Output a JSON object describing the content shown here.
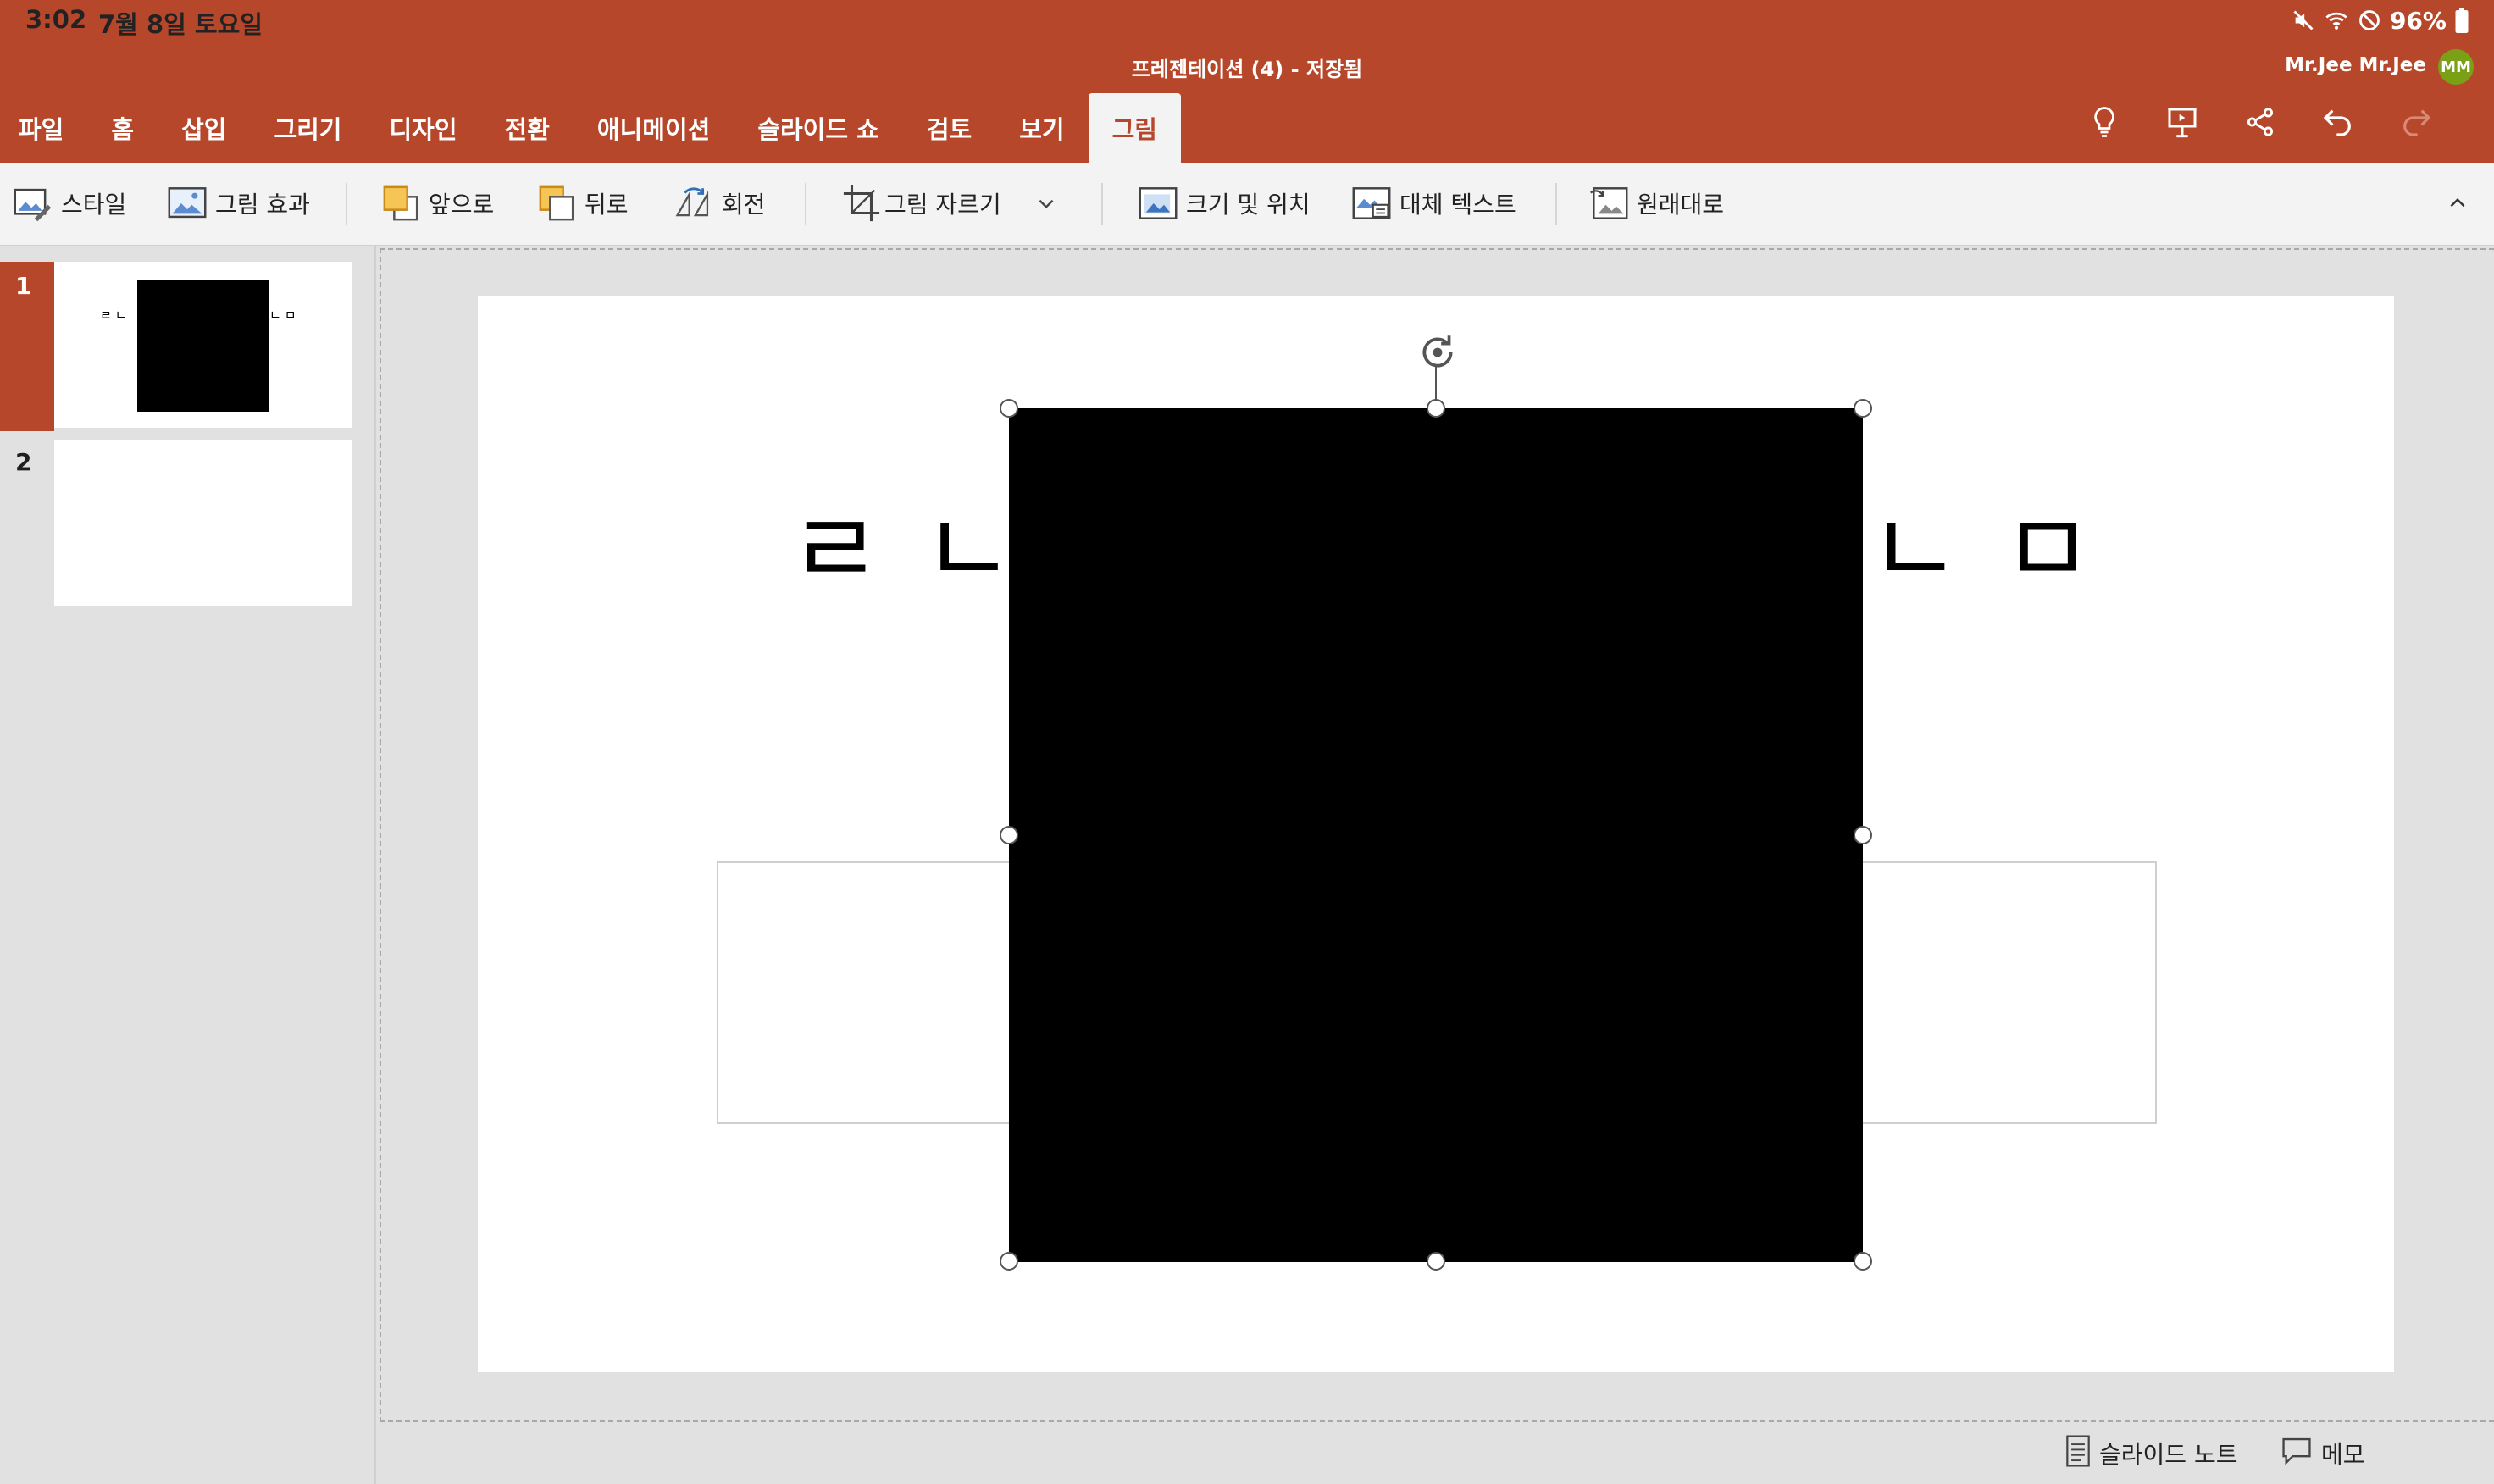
{
  "status_bar": {
    "time": "3:02",
    "date": "7월 8일 토요일",
    "battery": "96%",
    "icons": [
      "mute-icon",
      "wifi-icon",
      "do-not-disturb-icon",
      "battery-icon"
    ]
  },
  "app": {
    "document_title": "프레젠테이션 (4) - 저장됨",
    "user_name": "Mr.Jee Mr.Jee",
    "user_initials": "MM",
    "accent_color": "#b7472a",
    "avatar_color": "#7aa116"
  },
  "tabs": [
    {
      "label": "파일",
      "active": false
    },
    {
      "label": "홈",
      "active": false
    },
    {
      "label": "삽입",
      "active": false
    },
    {
      "label": "그리기",
      "active": false
    },
    {
      "label": "디자인",
      "active": false
    },
    {
      "label": "전환",
      "active": false
    },
    {
      "label": "애니메이션",
      "active": false
    },
    {
      "label": "슬라이드 쇼",
      "active": false
    },
    {
      "label": "검토",
      "active": false
    },
    {
      "label": "보기",
      "active": false
    },
    {
      "label": "그림",
      "active": true
    }
  ],
  "quick_actions": [
    "lightbulb-icon",
    "present-icon",
    "share-icon",
    "undo-icon",
    "redo-icon"
  ],
  "ribbon": {
    "style": "스타일",
    "picture_effects": "그림 효과",
    "bring_forward": "앞으로",
    "send_backward": "뒤로",
    "rotate": "회전",
    "crop": "그림 자르기",
    "size_position": "크기 및 위치",
    "alt_text": "대체 텍스트",
    "reset": "원래대로"
  },
  "slides": [
    {
      "number": "1",
      "selected": true,
      "left_text": "ㄹㄴ",
      "right_text": "ㄴㅁ"
    },
    {
      "number": "2",
      "selected": false
    }
  ],
  "slide_content": {
    "left_text": "ㄹㄴ",
    "right_text": "ㄴㅁ"
  },
  "bottom": {
    "notes": "슬라이드 노트",
    "comments": "메모"
  }
}
